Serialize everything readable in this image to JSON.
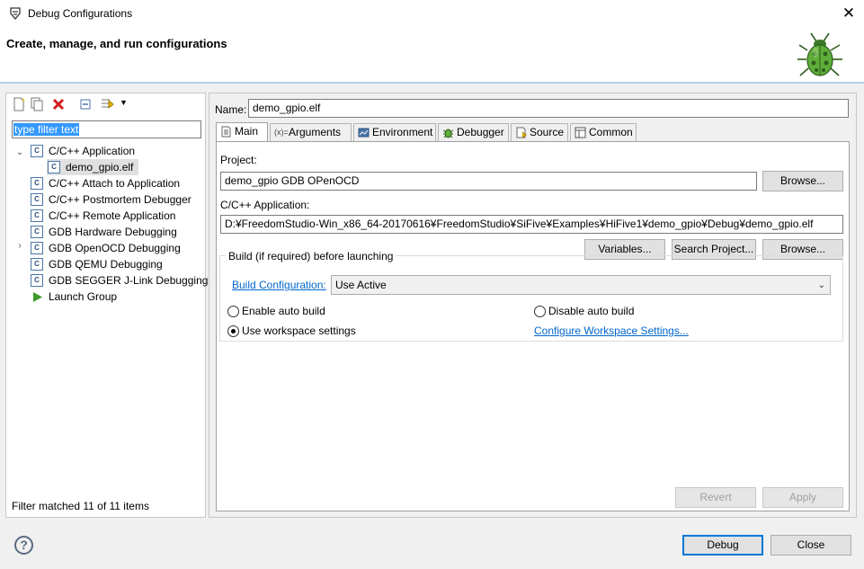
{
  "window": {
    "title": "Debug Configurations",
    "close_glyph": "✕"
  },
  "banner": {
    "heading": "Create, manage, and run configurations",
    "icon": "bug-icon"
  },
  "left": {
    "filter_placeholder": "type filter text",
    "tree": [
      {
        "label": "C/C++ Application",
        "expanded": true,
        "children": [
          {
            "label": "demo_gpio.elf",
            "selected": true
          }
        ]
      },
      {
        "label": "C/C++ Attach to Application"
      },
      {
        "label": "C/C++ Postmortem Debugger"
      },
      {
        "label": "C/C++ Remote Application"
      },
      {
        "label": "GDB Hardware Debugging"
      },
      {
        "label": "GDB OpenOCD Debugging",
        "collapsed": true
      },
      {
        "label": "GDB QEMU Debugging"
      },
      {
        "label": "GDB SEGGER J-Link Debugging"
      },
      {
        "label": "Launch Group"
      }
    ],
    "status": "Filter matched 11 of 11 items"
  },
  "right": {
    "name_label": "Name:",
    "name_value": "demo_gpio.elf",
    "tabs": [
      {
        "label": "Main",
        "active": true
      },
      {
        "label": "Arguments"
      },
      {
        "label": "Environment"
      },
      {
        "label": "Debugger"
      },
      {
        "label": "Source"
      },
      {
        "label": "Common"
      }
    ],
    "project_label": "Project:",
    "project_value": "demo_gpio GDB OPenOCD",
    "browse_label": "Browse...",
    "app_label": "C/C++ Application:",
    "app_value": "D:¥FreedomStudio-Win_x86_64-20170616¥FreedomStudio¥SiFive¥Examples¥HiFive1¥demo_gpio¥Debug¥demo_gpio.elf",
    "variables_label": "Variables...",
    "search_project_label": "Search Project...",
    "build_group_title": "Build (if required) before launching",
    "build_config_link": "Build Configuration:",
    "build_config_value": "Use Active",
    "enable_auto_build": "Enable auto build",
    "disable_auto_build": "Disable auto build",
    "use_workspace_settings": "Use workspace settings",
    "configure_workspace_link": "Configure Workspace Settings...",
    "revert_label": "Revert",
    "apply_label": "Apply"
  },
  "footer": {
    "debug_label": "Debug",
    "close_label": "Close"
  }
}
